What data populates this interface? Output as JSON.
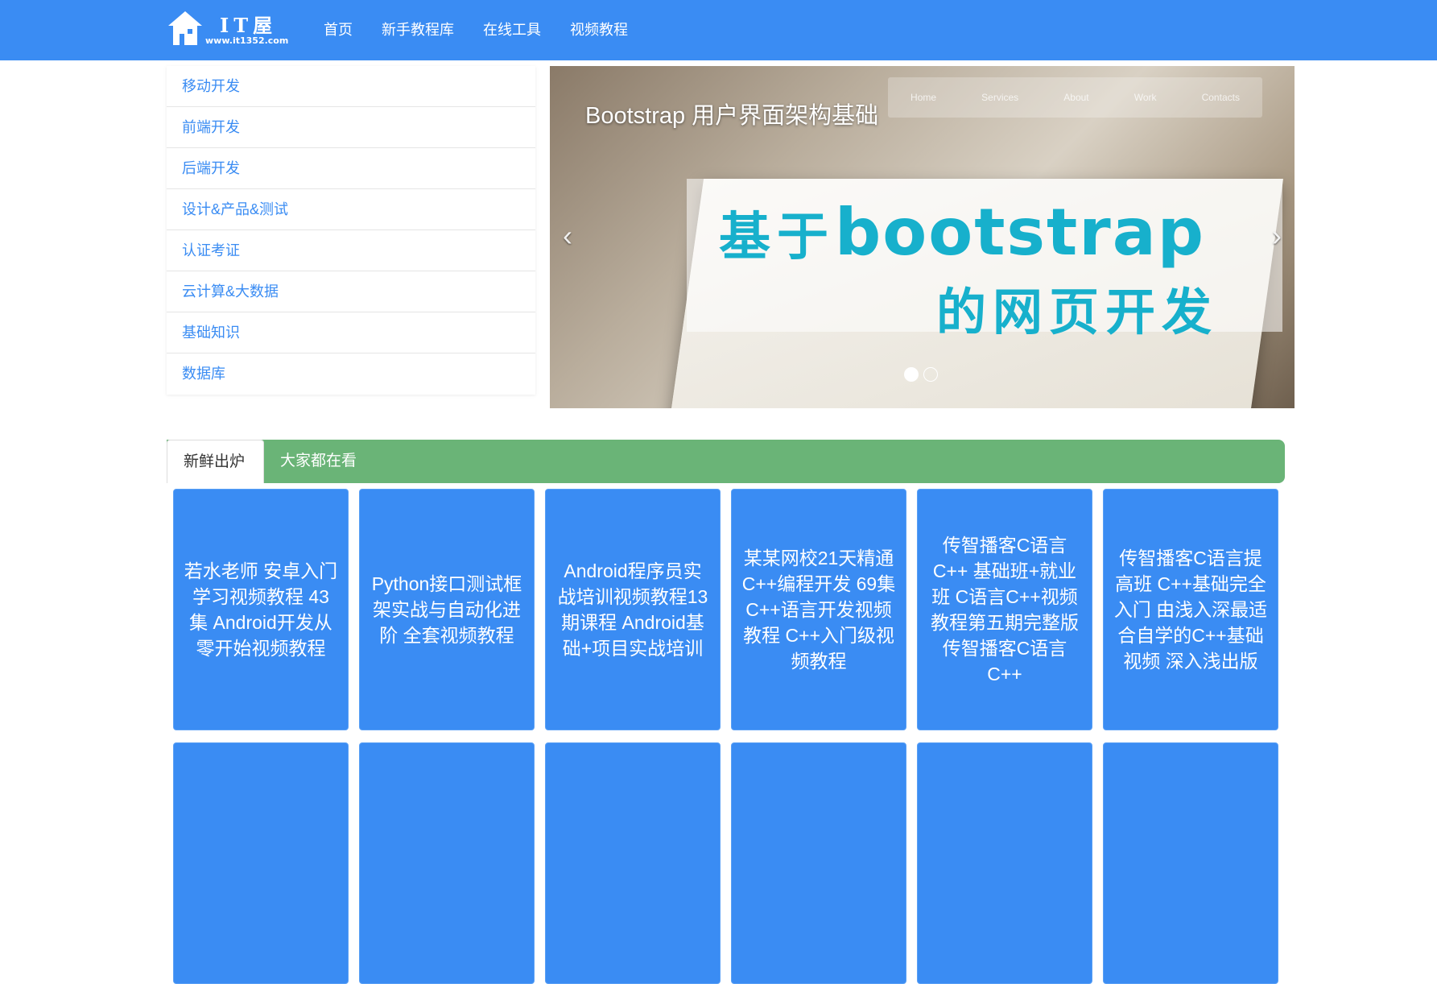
{
  "navbar": {
    "logo_text": "IT屋",
    "logo_url": "www.it1352.com",
    "links": [
      "首页",
      "新手教程库",
      "在线工具",
      "视频教程"
    ]
  },
  "sidebar": {
    "items": [
      {
        "label": "移动开发"
      },
      {
        "label": "前端开发"
      },
      {
        "label": "后端开发"
      },
      {
        "label": "设计&产品&测试"
      },
      {
        "label": "认证考证"
      },
      {
        "label": "云计算&大数据"
      },
      {
        "label": "基础知识"
      },
      {
        "label": "数据库"
      }
    ]
  },
  "carousel": {
    "caption": "Bootstrap 用户界面架构基础",
    "image_topbar": [
      "Home",
      "Services",
      "About",
      "Work",
      "Contacts"
    ],
    "image_title_cn": "基于",
    "image_title_en": "bootstrap",
    "image_title_line2": "的网页开发",
    "prev_icon": "‹",
    "next_icon": "›",
    "slide_count": 2,
    "active_slide": 1
  },
  "tabs": {
    "items": [
      {
        "label": "新鲜出炉",
        "active": true
      },
      {
        "label": "大家都在看",
        "active": false
      }
    ],
    "bar_color": "#6ab477"
  },
  "cards": [
    {
      "title": "若水老师 安卓入门学习视频教程 43集 Android开发从零开始视频教程"
    },
    {
      "title": "Python接口测试框架实战与自动化进阶 全套视频教程"
    },
    {
      "title": "Android程序员实战培训视频教程13期课程 Android基础+项目实战培训"
    },
    {
      "title": "某某网校21天精通C++编程开发 69集 C++语言开发视频教程 C++入门级视频教程"
    },
    {
      "title": "传智播客C语言C++ 基础班+就业班 C语言C++视频教程第五期完整版 传智播客C语言C++"
    },
    {
      "title": "传智播客C语言提高班 C++基础完全入门 由浅入深最适合自学的C++基础视频 深入浅出版"
    },
    {
      "title": ""
    },
    {
      "title": ""
    },
    {
      "title": ""
    },
    {
      "title": ""
    },
    {
      "title": ""
    },
    {
      "title": ""
    }
  ],
  "colors": {
    "brand": "#3a8cf3",
    "tab_green": "#6ab477",
    "sidebar_text": "#3a8cf3"
  }
}
